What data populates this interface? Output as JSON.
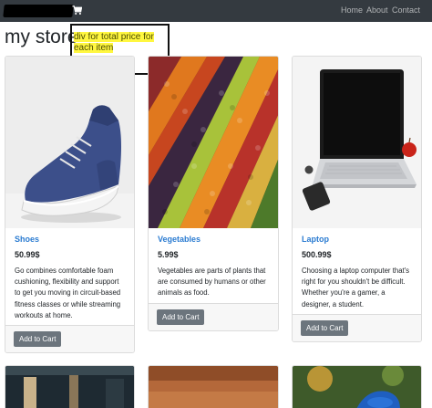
{
  "navbar": {
    "nav_links": [
      "Home",
      "About",
      "Contact"
    ]
  },
  "page": {
    "title": "my store"
  },
  "annotation": {
    "text": "div for total price for each item"
  },
  "products": [
    {
      "name": "Shoes",
      "price": "50.99$",
      "description": "Go combines comfortable foam cushioning, flexibility and support to get you moving in circuit-based fitness classes or while streaming workouts at home.",
      "button": "Add to Cart",
      "image_icon": "sneaker-image"
    },
    {
      "name": "Vegetables",
      "price": "5.99$",
      "description": "Vegetables are parts of plants that are consumed by humans or other animals as food.",
      "button": "Add to Cart",
      "image_icon": "vegetables-image"
    },
    {
      "name": "Laptop",
      "price": "500.99$",
      "description": "Choosing a laptop computer that's right for you shouldn't be difficult. Whether you're a gamer, a designer, a student.",
      "button": "Add to Cart",
      "image_icon": "laptop-image"
    }
  ],
  "colors": {
    "navbar": "#343a40",
    "link": "#2a7bd1",
    "button": "#6c757d",
    "highlight": "#fff740"
  }
}
